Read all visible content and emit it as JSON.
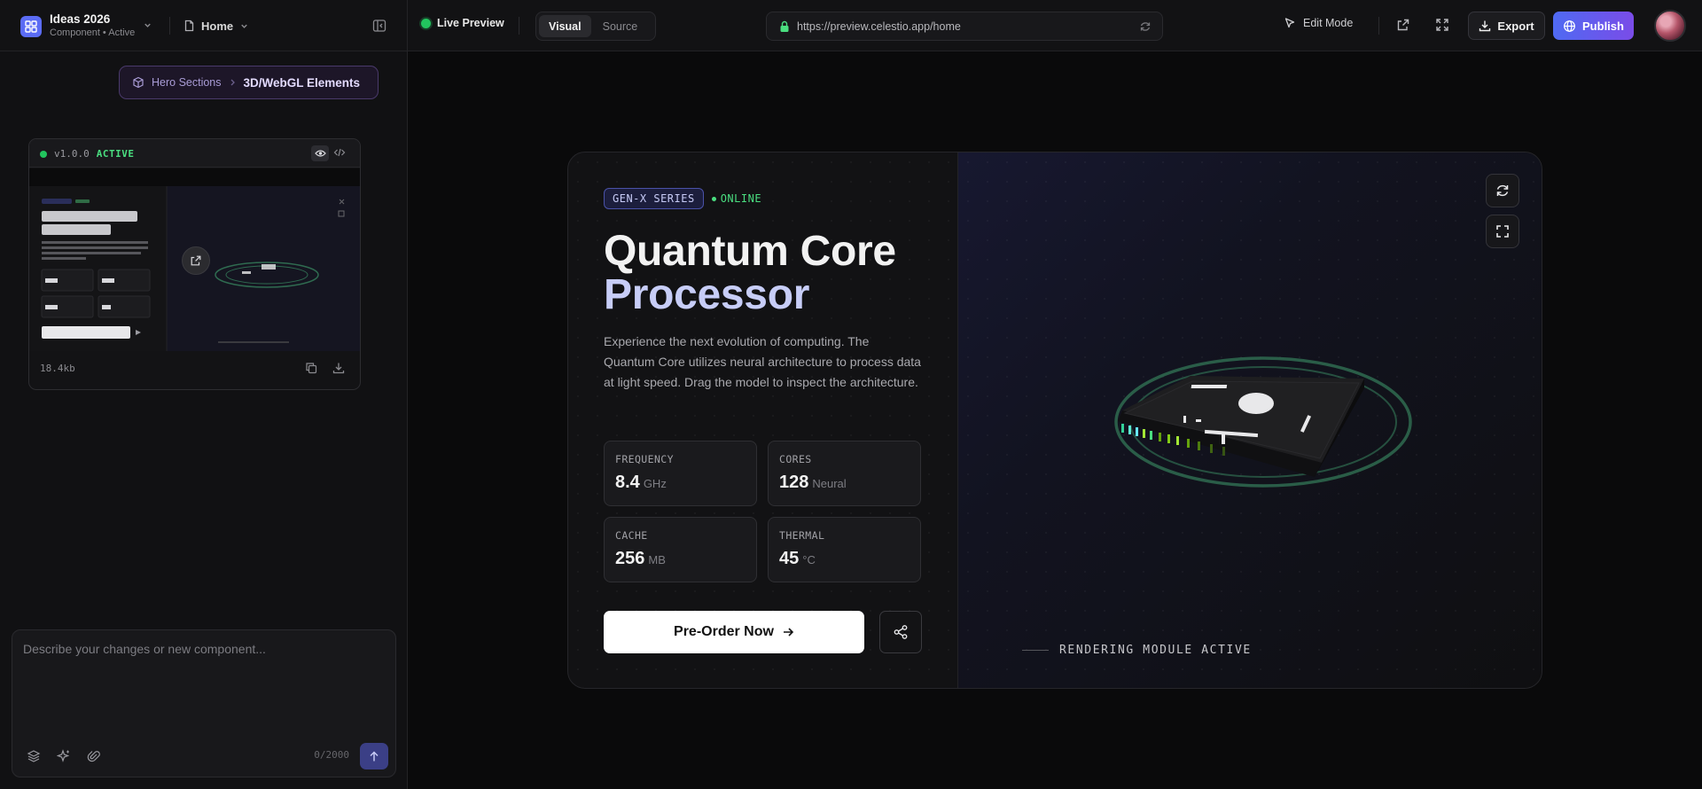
{
  "app": {
    "title": "Ideas 2026",
    "subtitle": "Component • Active"
  },
  "page_selector": {
    "label": "Home"
  },
  "preview": {
    "status": "Live Preview",
    "tabs": [
      {
        "label": "Visual",
        "active": true
      },
      {
        "label": "Source",
        "active": false
      }
    ]
  },
  "url_bar": {
    "url": "https://preview.celestio.app/home"
  },
  "toolbar": {
    "edit_mode": "Edit Mode",
    "export": "Export",
    "publish": "Publish"
  },
  "breadcrumb": {
    "parent": "Hero Sections",
    "current": "3D/WebGL Elements"
  },
  "version_card": {
    "version": "v1.0.0",
    "status": "ACTIVE",
    "size": "18.4kb"
  },
  "prompt": {
    "placeholder": "Describe your changes or new component...",
    "count": "0/2000"
  },
  "hero": {
    "tag": "GEN-X SERIES",
    "status": "ONLINE",
    "title_line1": "Quantum Core",
    "title_line2": "Processor",
    "description": "Experience the next evolution of computing. The Quantum Core utilizes neural architecture to process data at light speed. Drag the model to inspect the architecture.",
    "stats": [
      {
        "label": "FREQUENCY",
        "value": "8.4",
        "unit": "GHz"
      },
      {
        "label": "CORES",
        "value": "128",
        "unit": "Neural"
      },
      {
        "label": "CACHE",
        "value": "256",
        "unit": "MB"
      },
      {
        "label": "THERMAL",
        "value": "45",
        "unit": "°C"
      }
    ],
    "cta": "Pre-Order Now",
    "render_status": "RENDERING MODULE ACTIVE"
  },
  "colors": {
    "accent": "#5b6cf5",
    "online": "#4ade80",
    "publish_from": "#4f6af2",
    "publish_to": "#7a4ce8",
    "ring": "#3d7a5e"
  }
}
